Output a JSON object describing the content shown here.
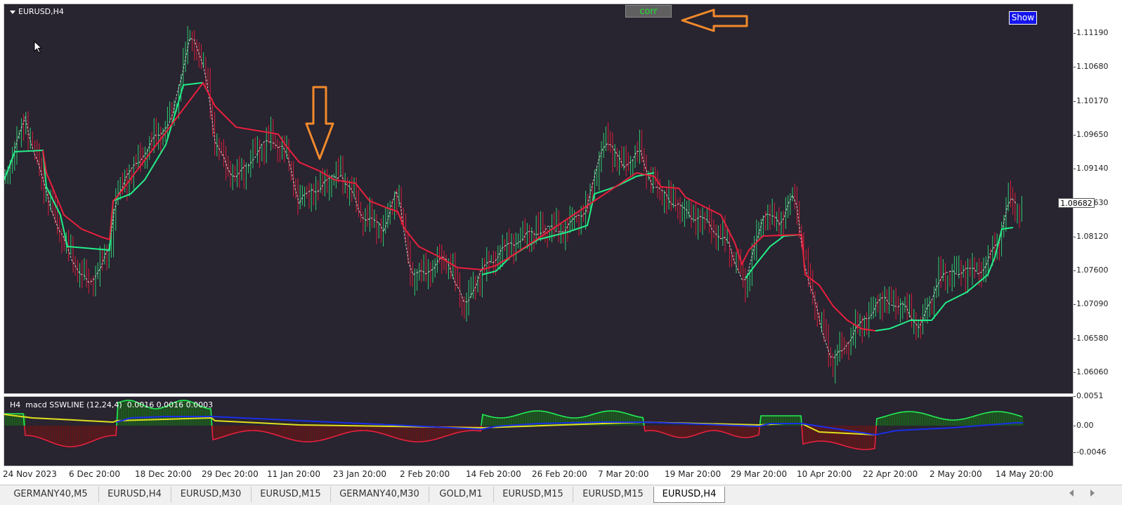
{
  "chart": {
    "symbol_label": "EURUSD,H4",
    "corr_button": "corr",
    "show_button": "Show",
    "current_price": "1.08682",
    "price_ticks": [
      "1.11190",
      "1.10680",
      "1.10170",
      "1.09650",
      "1.09140",
      "1.08630",
      "1.08120",
      "1.07600",
      "1.07090",
      "1.06580",
      "1.06060"
    ],
    "time_ticks": [
      "24 Nov 2023",
      "6 Dec 20:00",
      "18 Dec 20:00",
      "29 Dec 20:00",
      "11 Jan 20:00",
      "23 Jan 20:00",
      "2 Feb 20:00",
      "14 Feb 20:00",
      "26 Feb 20:00",
      "7 Mar 20:00",
      "19 Mar 20:00",
      "29 Mar 20:00",
      "10 Apr 20:00",
      "22 Apr 20:00",
      "2 May 20:00",
      "14 May 20:00"
    ],
    "colors": {
      "background": "#282430",
      "bull": "#2ecc71",
      "bear": "#d81e3c",
      "support_line": "#22ee88",
      "resist_line": "#e8203c",
      "arrow": "#f28a2b"
    }
  },
  "indicator": {
    "label": "H4  macd SSWLINE (12,24,4)  0.0016 0.0016 0.0003",
    "scale_ticks": [
      "0.0051",
      "0.00",
      "-0.0046"
    ],
    "colors": {
      "positive": "#22ee55",
      "negative": "#e8203c",
      "signal": "#e0e020",
      "baseline": "#1a2ee8"
    }
  },
  "tabs": [
    {
      "label": "GERMANY40,M5",
      "active": false
    },
    {
      "label": "EURUSD,H4",
      "active": false
    },
    {
      "label": "EURUSD,M30",
      "active": false
    },
    {
      "label": "EURUSD,M15",
      "active": false
    },
    {
      "label": "GERMANY40,M30",
      "active": false
    },
    {
      "label": "GOLD,M1",
      "active": false
    },
    {
      "label": "EURUSD,M15",
      "active": false
    },
    {
      "label": "EURUSD,M15",
      "active": false
    },
    {
      "label": "EURUSD,H4",
      "active": true
    }
  ]
}
